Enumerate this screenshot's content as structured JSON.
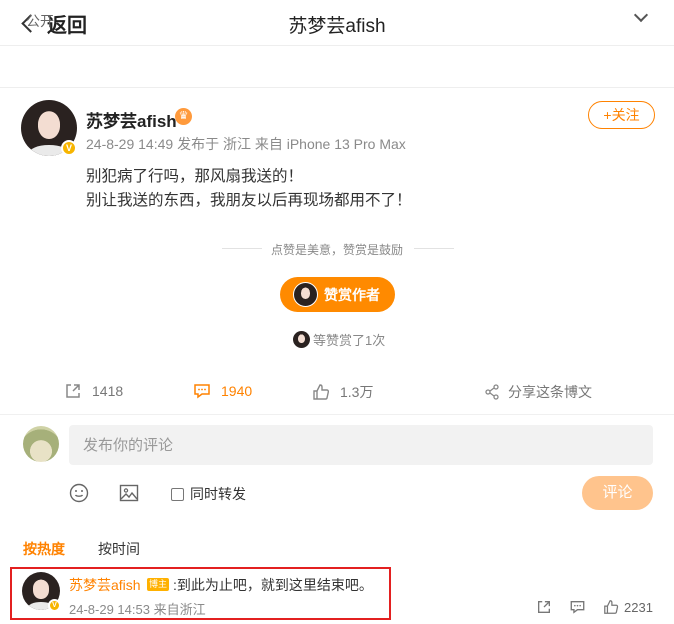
{
  "header": {
    "back_label": "返回",
    "title": "苏梦芸afish"
  },
  "visibility": {
    "label": "公开",
    "icon": "chevron-down-icon"
  },
  "post": {
    "author": "苏梦芸afish",
    "verified_badge": "V",
    "meta": "24-8-29 14:49  发布于 浙江  来自 iPhone 13 Pro Max",
    "follow_label": "+关注",
    "lines": [
      "别犯病了行吗，那风扇我送的！",
      "别让我送的东西，我朋友以后再现场都用不了！"
    ]
  },
  "reward": {
    "tagline": "点赞是美意，赞赏是鼓励",
    "button_label": "赞赏作者",
    "rewarded_text": "等赞赏了1次"
  },
  "actions": {
    "reposts": "1418",
    "comments": "1940",
    "likes": "1.3万",
    "share_label": "分享这条博文"
  },
  "composer": {
    "placeholder": "发布你的评论",
    "forward_label": "同时转发",
    "submit_label": "评论"
  },
  "sort_tabs": {
    "hot": "按热度",
    "time": "按时间"
  },
  "comment": {
    "author": "苏梦芸afish",
    "tag": "博主",
    "text": ":到此为止吧，就到这里结束吧。",
    "meta": "24-8-29 14:53  来自浙江",
    "likes": "2231"
  },
  "colors": {
    "accent": "#ff8200",
    "highlight_border": "#e32020",
    "submit_disabled": "#ffc48d"
  }
}
